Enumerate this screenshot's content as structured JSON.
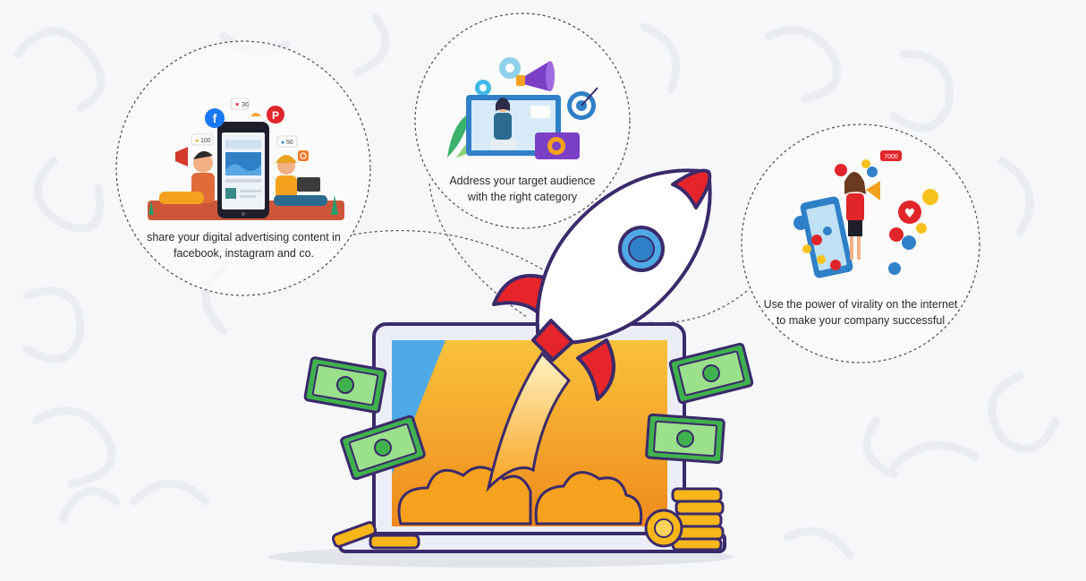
{
  "bubbles": {
    "social": {
      "line1": "share your digital advertising content in",
      "line2": "facebook, instagram and co."
    },
    "audience": {
      "line1": "Address your target audience",
      "line2": "with the right category"
    },
    "virality": {
      "line1": "Use the power of virality on the internet",
      "line2": "to make your company successful"
    }
  },
  "phone_badges": {
    "likes_a": "30",
    "likes_b": "100",
    "likes_c": "50"
  },
  "viral_badge": "7000",
  "icons": [
    "facebook-icon",
    "pinterest-icon",
    "instagram-icon",
    "gear-icon",
    "megaphone-icon",
    "target-icon",
    "camera-icon",
    "heart-icon",
    "thumbs-up-icon",
    "emoji-icon",
    "rocket-icon",
    "laptop-icon",
    "banknote-icon",
    "coin-icon"
  ],
  "colors": {
    "rocket_red": "#e5252b",
    "rocket_white": "#ffffff",
    "outline": "#3b2a6b",
    "screen_orange": "#f4a81d",
    "money_green": "#3fb24d",
    "coin_gold": "#f7b619"
  }
}
